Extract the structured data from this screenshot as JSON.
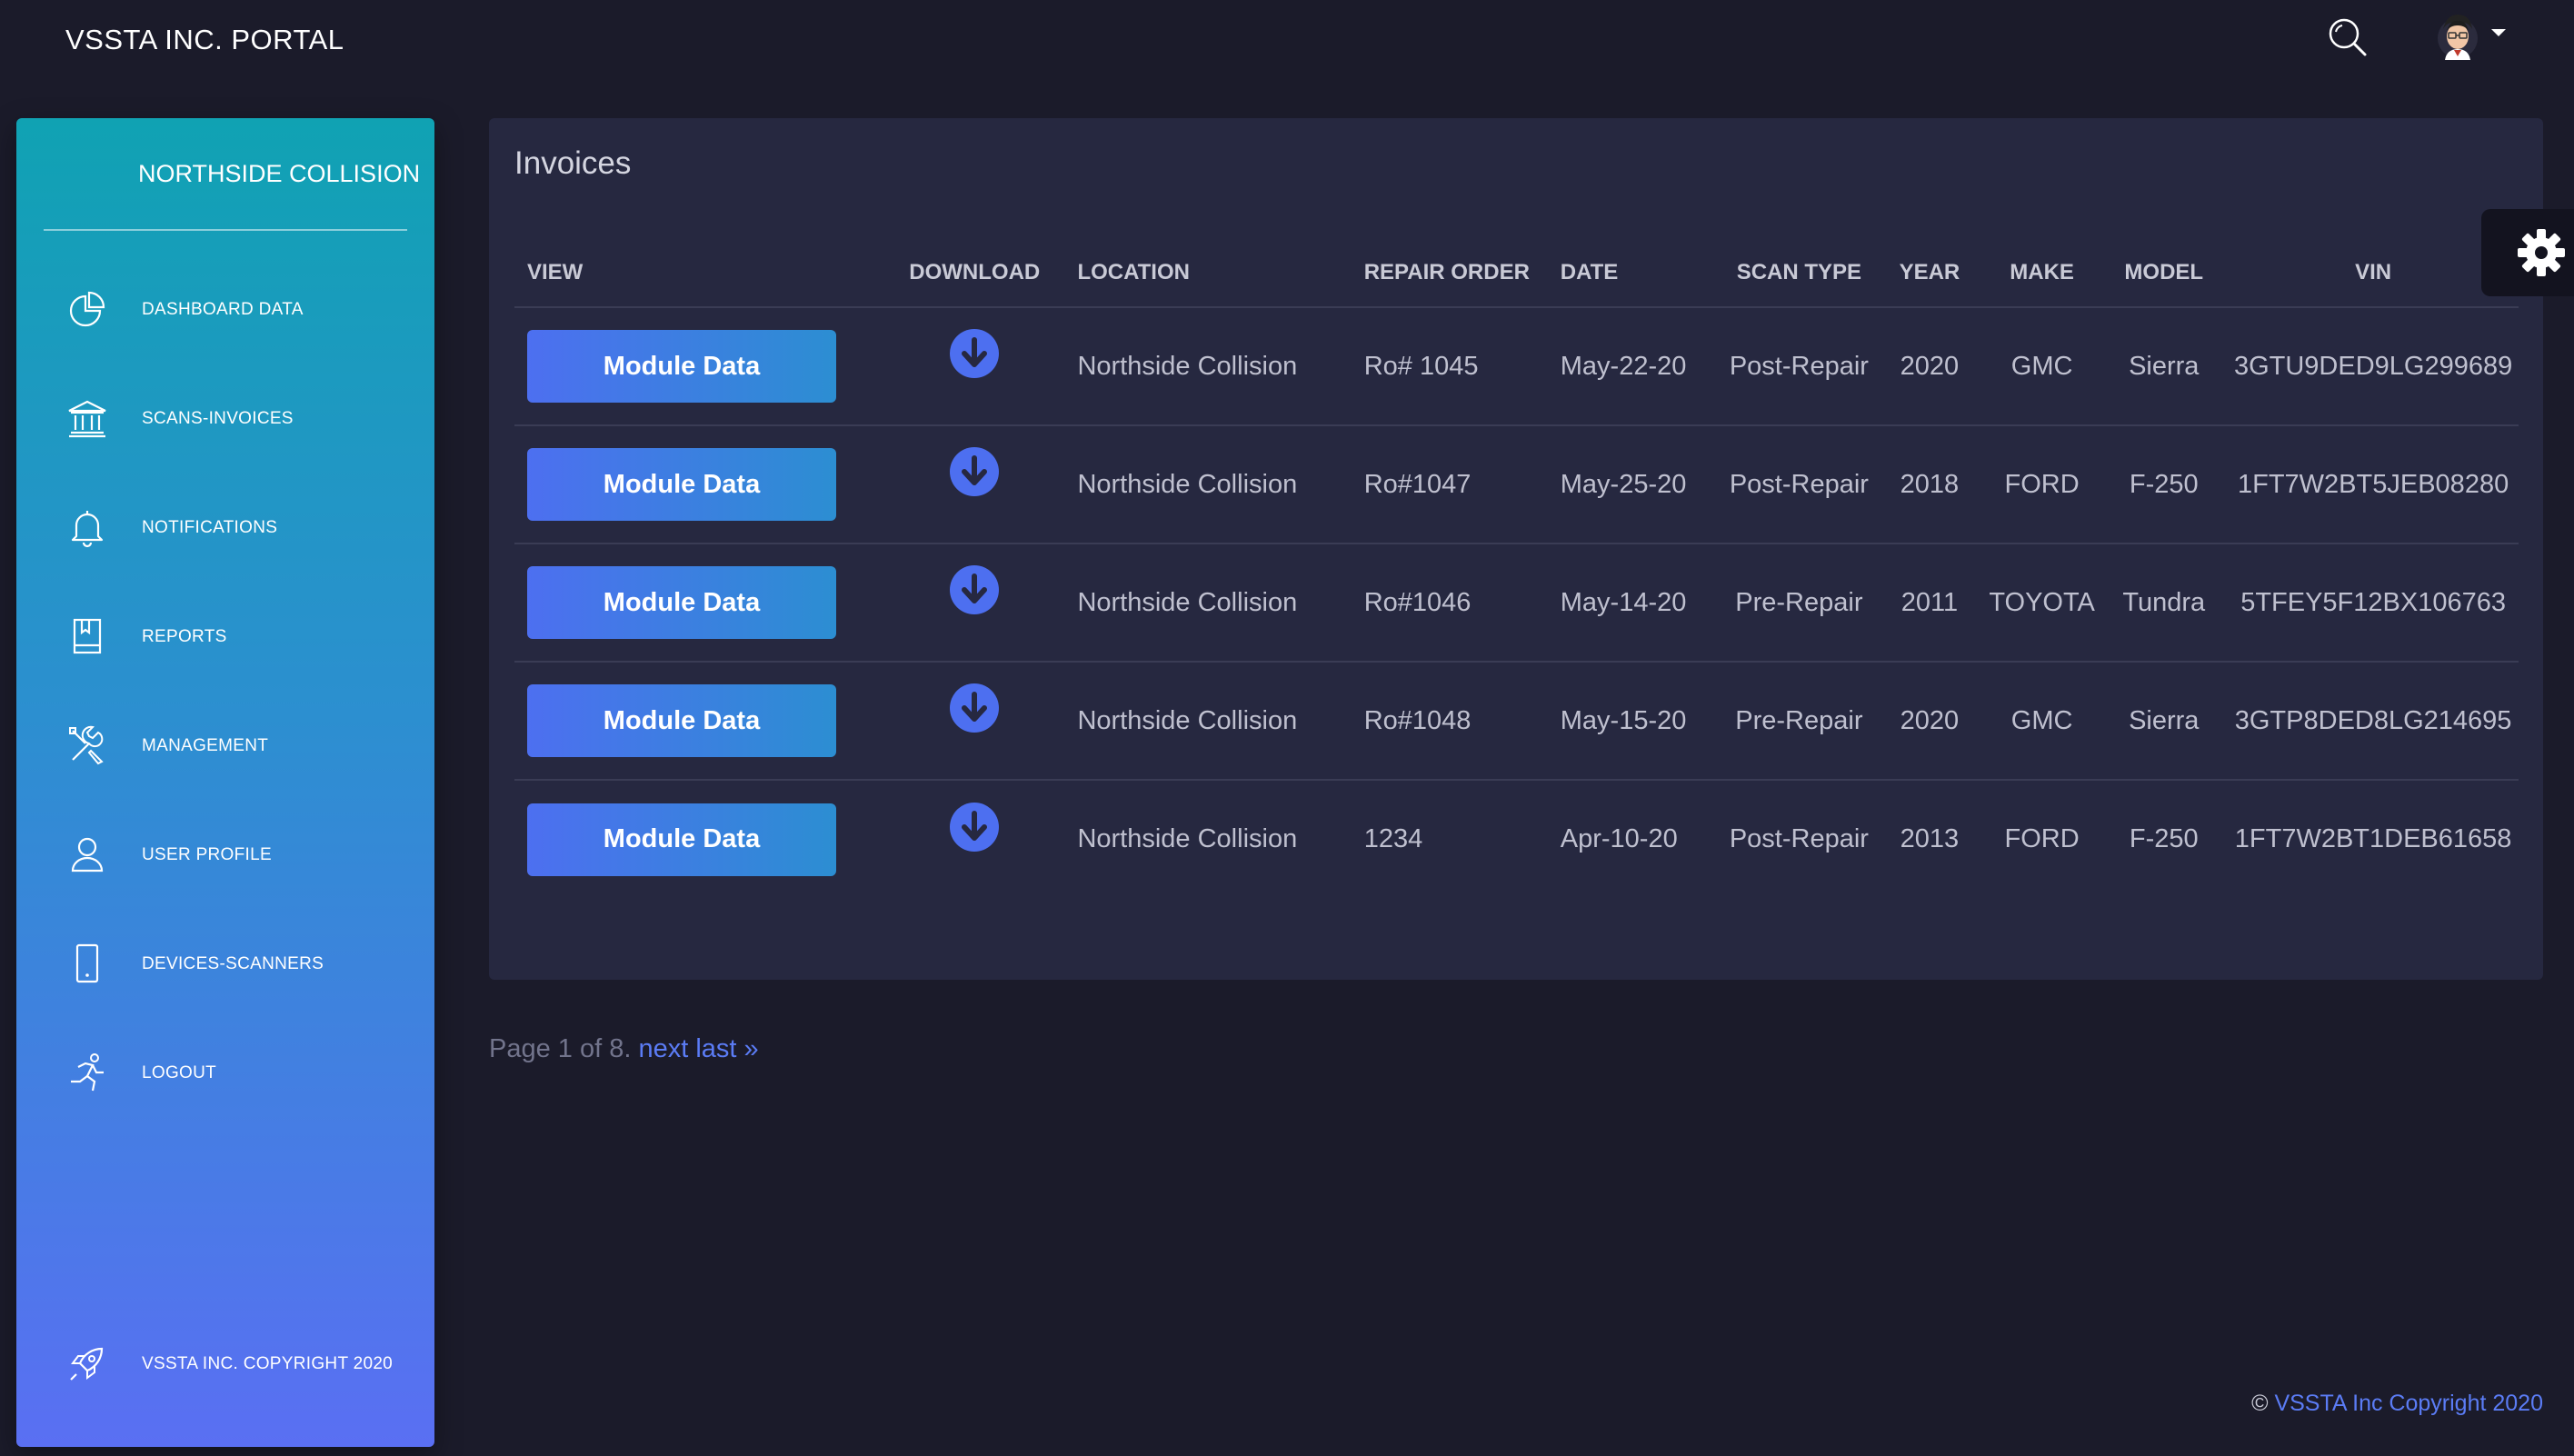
{
  "app": {
    "title": "VSSTA INC. PORTAL"
  },
  "sidebar": {
    "title": "NORTHSIDE COLLISION",
    "items": [
      {
        "label": "DASHBOARD DATA",
        "icon": "pie-chart-icon"
      },
      {
        "label": "SCANS-INVOICES",
        "icon": "bank-icon"
      },
      {
        "label": "NOTIFICATIONS",
        "icon": "bell-icon"
      },
      {
        "label": "REPORTS",
        "icon": "book-icon"
      },
      {
        "label": "MANAGEMENT",
        "icon": "tools-icon"
      },
      {
        "label": "USER PROFILE",
        "icon": "user-icon"
      },
      {
        "label": "DEVICES-SCANNERS",
        "icon": "tablet-icon"
      },
      {
        "label": "LOGOUT",
        "icon": "runner-icon"
      }
    ],
    "footer": "VSSTA INC. COPYRIGHT 2020"
  },
  "main": {
    "title": "Invoices",
    "columns": [
      "VIEW",
      "DOWNLOAD",
      "LOCATION",
      "REPAIR ORDER",
      "DATE",
      "SCAN TYPE",
      "YEAR",
      "MAKE",
      "MODEL",
      "VIN"
    ],
    "button_label": "Module Data",
    "rows": [
      {
        "location": "Northside Collision",
        "repair_order": "Ro# 1045",
        "date": "May-22-20",
        "scan_type": "Post-Repair",
        "year": "2020",
        "make": "GMC",
        "model": "Sierra",
        "vin": "3GTU9DED9LG299689"
      },
      {
        "location": "Northside Collision",
        "repair_order": "Ro#1047",
        "date": "May-25-20",
        "scan_type": "Post-Repair",
        "year": "2018",
        "make": "FORD",
        "model": "F-250",
        "vin": "1FT7W2BT5JEB08280"
      },
      {
        "location": "Northside Collision",
        "repair_order": "Ro#1046",
        "date": "May-14-20",
        "scan_type": "Pre-Repair",
        "year": "2011",
        "make": "TOYOTA",
        "model": "Tundra",
        "vin": "5TFEY5F12BX106763"
      },
      {
        "location": "Northside Collision",
        "repair_order": "Ro#1048",
        "date": "May-15-20",
        "scan_type": "Pre-Repair",
        "year": "2020",
        "make": "GMC",
        "model": "Sierra",
        "vin": "3GTP8DED8LG214695"
      },
      {
        "location": "Northside Collision",
        "repair_order": "1234",
        "date": "Apr-10-20",
        "scan_type": "Post-Repair",
        "year": "2013",
        "make": "FORD",
        "model": "F-250",
        "vin": "1FT7W2BT1DEB61658"
      }
    ]
  },
  "pagination": {
    "text": "Page 1 of 8.",
    "next": "next",
    "last": "last »"
  },
  "footer": {
    "symbol": "©",
    "link": "VSSTA Inc Copyright 2020"
  },
  "colors": {
    "background": "#1b1b2a",
    "card": "#262840",
    "accent": "#5b7cf5",
    "sidebar_top": "#10a2b3",
    "sidebar_bottom": "#5a6ff3"
  }
}
